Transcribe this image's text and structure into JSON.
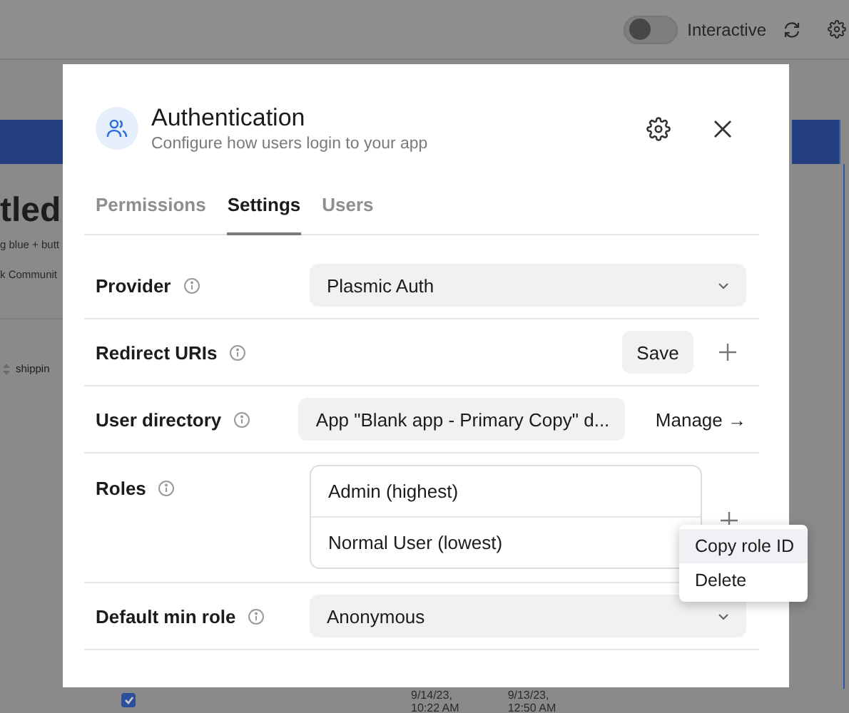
{
  "background": {
    "toolbar": {
      "interactive_toggle": {
        "label": "Interactive",
        "on": false
      }
    },
    "page_title": "tled",
    "page_subtitle": "g blue + butt",
    "page_link": "k Communit",
    "column_header": "shippin",
    "table_row": {
      "checked": true,
      "cells": [
        [
          "9/14/23,",
          "10:22 AM"
        ],
        [
          "9/13/23,",
          "12:50 AM"
        ]
      ]
    }
  },
  "modal": {
    "title": "Authentication",
    "subtitle": "Configure how users login to your app",
    "tabs": [
      {
        "label": "Permissions",
        "selected": false
      },
      {
        "label": "Settings",
        "selected": true
      },
      {
        "label": "Users",
        "selected": false
      }
    ],
    "rows": [
      {
        "kind": "select",
        "label": "Provider",
        "value": "Plasmic Auth"
      },
      {
        "kind": "actions",
        "label": "Redirect URIs",
        "button": "Save"
      },
      {
        "kind": "select_link",
        "label": "User directory",
        "value": "App \"Blank app - Primary Copy\" d...",
        "link": "Manage →"
      },
      {
        "kind": "roles",
        "label": "Roles",
        "roles": [
          {
            "name": "Admin (highest)"
          },
          {
            "name": "Normal User (lowest)"
          }
        ]
      },
      {
        "kind": "select",
        "label": "Default min role",
        "value": "Anonymous"
      }
    ]
  },
  "context_menu": {
    "items": [
      {
        "label": "Copy role ID",
        "selected": true
      },
      {
        "label": "Delete",
        "selected": false
      }
    ]
  }
}
